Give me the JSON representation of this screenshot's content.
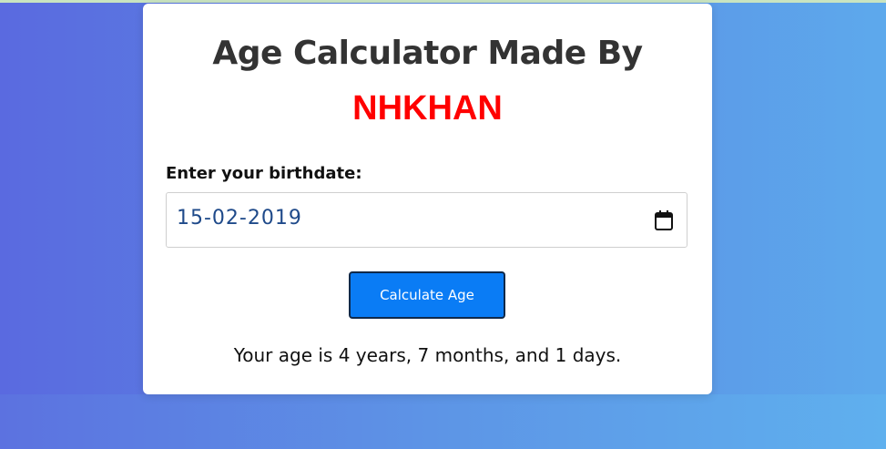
{
  "header": {
    "title_line1": "Age Calculator Made By",
    "title_line2": "NHKHAN"
  },
  "form": {
    "label": "Enter your birthdate:",
    "birthdate_value": "15-02-2019",
    "calendar_icon": "calendar-icon",
    "button_label": "Calculate Age"
  },
  "result": {
    "text": "Your age is 4 years, 7 months, and 1 days."
  },
  "colors": {
    "accent_red": "#ff0000",
    "button_blue": "#0a7cf5",
    "date_text": "#1f4a8a",
    "bg_gradient_start": "#5a6ae0",
    "bg_gradient_end": "#5da9ec"
  }
}
